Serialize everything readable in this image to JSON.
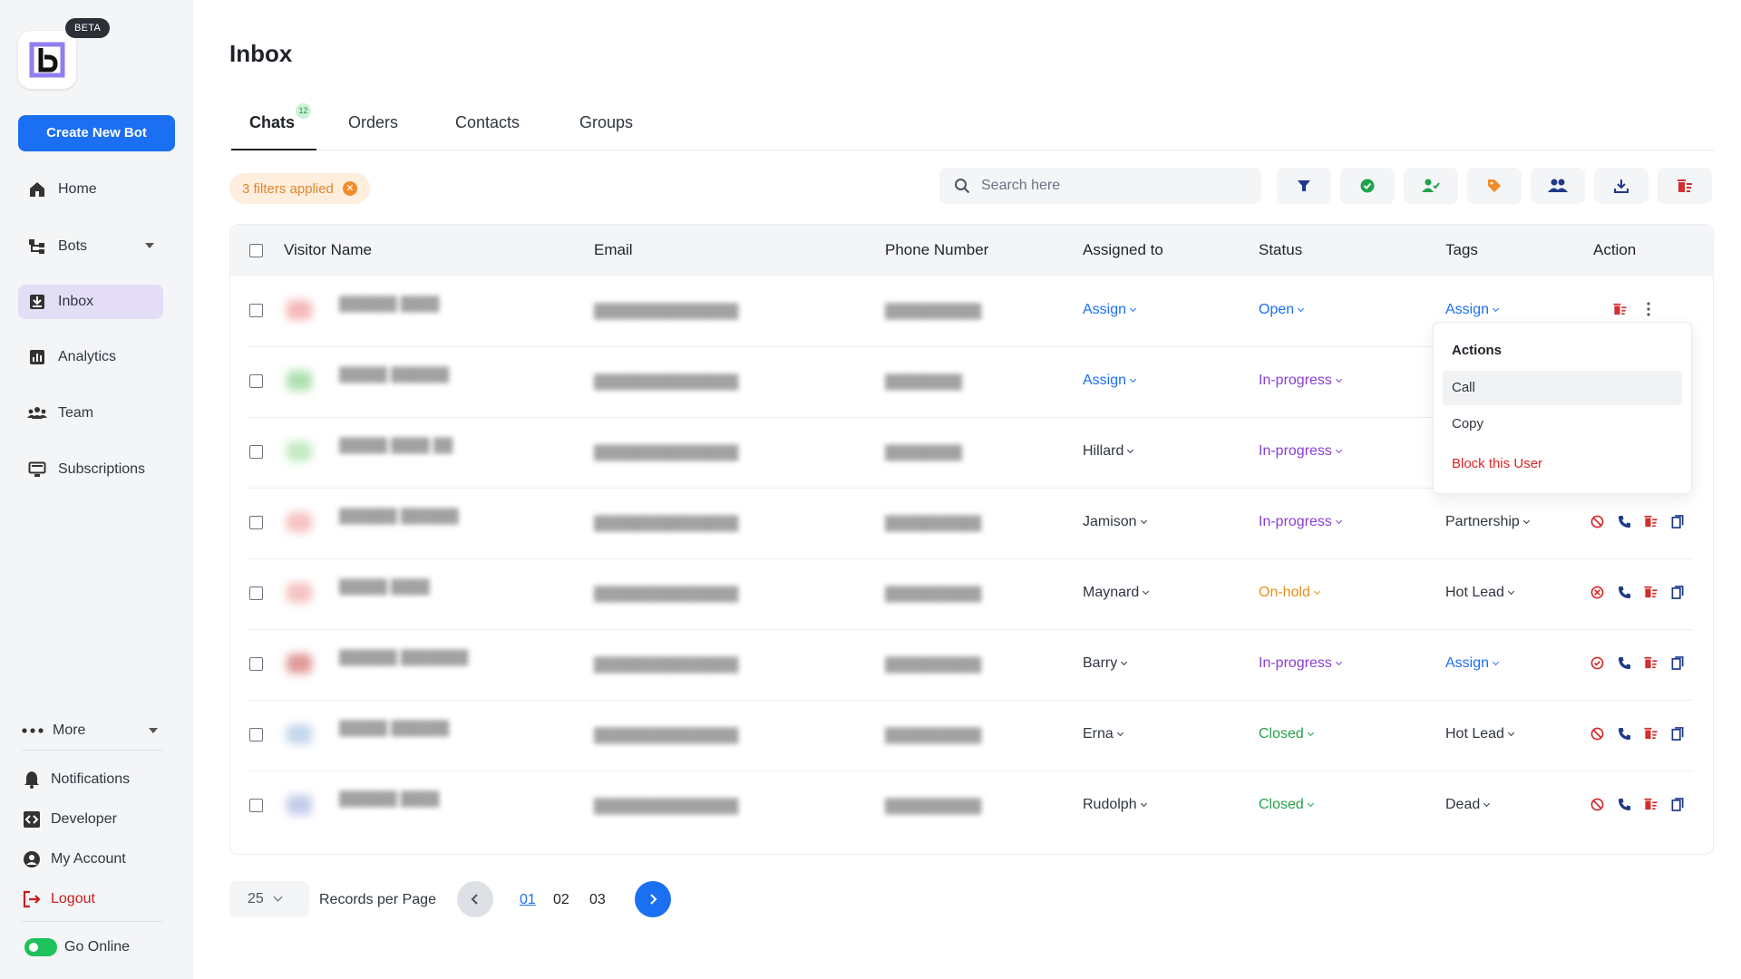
{
  "sidebar": {
    "beta_label": "BETA",
    "create_button": "Create New Bot",
    "nav": [
      {
        "label": "Home",
        "icon": "home-icon"
      },
      {
        "label": "Bots",
        "icon": "bots-icon"
      },
      {
        "label": "Inbox",
        "icon": "inbox-icon"
      },
      {
        "label": "Analytics",
        "icon": "analytics-icon"
      },
      {
        "label": "Team",
        "icon": "team-icon"
      },
      {
        "label": "Subscriptions",
        "icon": "subscriptions-icon"
      }
    ],
    "more_label": "More",
    "bottom": [
      {
        "label": "Notifications",
        "icon": "bell-icon"
      },
      {
        "label": "Developer",
        "icon": "code-icon"
      },
      {
        "label": "My Account",
        "icon": "account-icon"
      },
      {
        "label": "Logout",
        "icon": "logout-icon"
      }
    ],
    "go_online": "Go Online"
  },
  "page": {
    "title": "Inbox",
    "tabs": [
      {
        "label": "Chats",
        "badge": "12",
        "active": true
      },
      {
        "label": "Orders"
      },
      {
        "label": "Contacts"
      },
      {
        "label": "Groups"
      }
    ],
    "filters_chip": "3 filters applied",
    "search_placeholder": "Search here"
  },
  "table": {
    "columns": [
      "Visitor Name",
      "Email",
      "Phone Number",
      "Assigned to",
      "Status",
      "Tags",
      "Action"
    ],
    "rows": [
      {
        "assigned": "Assign",
        "status": "Open",
        "status_color": "#1a6ff3",
        "tags": "Assign",
        "tags_color": "#1a6ff3",
        "avatar": "#e88",
        "assigned_color": "#1a6ff3"
      },
      {
        "assigned": "Assign",
        "status": "In-progress",
        "status_color": "#8a3ed0",
        "tags": "",
        "avatar": "#7c7",
        "assigned_color": "#1a6ff3"
      },
      {
        "assigned": "Hillard",
        "status": "In-progress",
        "status_color": "#8a3ed0",
        "tags": "",
        "avatar": "#9d9",
        "assigned_color": "#2f3640"
      },
      {
        "assigned": "Jamison",
        "status": "In-progress",
        "status_color": "#8a3ed0",
        "tags": "Partnership",
        "tags_color": "#2f3640",
        "avatar": "#e99",
        "assigned_color": "#2f3640"
      },
      {
        "assigned": "Maynard",
        "status": "On-hold",
        "status_color": "#e8901a",
        "tags": "Hot Lead",
        "tags_color": "#2f3640",
        "avatar": "#e99",
        "assigned_color": "#2f3640"
      },
      {
        "assigned": "Barry",
        "status": "In-progress",
        "status_color": "#8a3ed0",
        "tags": "Assign",
        "tags_color": "#1a6ff3",
        "avatar": "#c55",
        "assigned_color": "#2f3640"
      },
      {
        "assigned": "Erna",
        "status": "Closed",
        "status_color": "#25a24a",
        "tags": "Hot Lead",
        "tags_color": "#2f3640",
        "avatar": "#9bd",
        "assigned_color": "#2f3640"
      },
      {
        "assigned": "Rudolph",
        "status": "Closed",
        "status_color": "#25a24a",
        "tags": "Dead",
        "tags_color": "#2f3640",
        "avatar": "#9ad",
        "assigned_color": "#2f3640"
      }
    ]
  },
  "actions_menu": {
    "title": "Actions",
    "items": [
      "Call",
      "Copy",
      "Block this User"
    ]
  },
  "pagination": {
    "per_page": "25",
    "per_page_label": "Records per Page",
    "pages": [
      "01",
      "02",
      "03"
    ]
  },
  "colors": {
    "accent": "#1a6ff3",
    "danger": "#e02424"
  }
}
